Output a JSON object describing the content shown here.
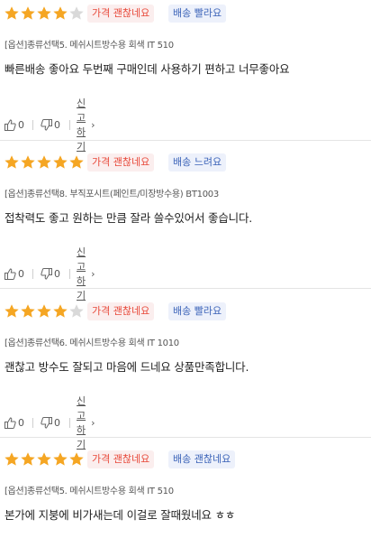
{
  "colors": {
    "star_filled": "#f5a623",
    "star_empty": "#d9d9d9",
    "price_tag_text": "#e8493a",
    "shipping_tag_text": "#3b63b8"
  },
  "actions": {
    "like_icon": "thumbs-up-icon",
    "dislike_icon": "thumbs-down-icon",
    "report_label": "신고하기",
    "report_chevron": "›"
  },
  "reviews": [
    {
      "rating": 4,
      "price_tag": "가격 괜찮네요",
      "shipping_tag": "배송 빨라요",
      "option": "[옵션]종류선택5. 메쉬시트방수용 회색 IT 510",
      "content": "빠른배송 좋아요 두번째 구매인데 사용하기 편하고 너무좋아요",
      "likes": "0",
      "dislikes": "0"
    },
    {
      "rating": 5,
      "price_tag": "가격 괜찮네요",
      "shipping_tag": "배송 느려요",
      "option": "[옵션]종류선택8. 부직포시트(페인트/미장방수용) BT1003",
      "content": "접착력도 좋고 원하는 만큼 잘라 쓸수있어서 좋습니다.",
      "likes": "0",
      "dislikes": "0"
    },
    {
      "rating": 4,
      "price_tag": "가격 괜찮네요",
      "shipping_tag": "배송 빨라요",
      "option": "[옵션]종류선택6. 메쉬시트방수용 회색 IT 1010",
      "content": "괜찮고 방수도 잘되고 마음에 드네요 상품만족합니다.",
      "likes": "0",
      "dislikes": "0"
    },
    {
      "rating": 5,
      "price_tag": "가격 괜찮네요",
      "shipping_tag": "배송 괜찮네요",
      "option": "[옵션]종류선택5. 메쉬시트방수용 회색 IT 510",
      "content": "본가에 지붕에 비가새는데 이걸로 잘때웠네요 ㅎㅎ"
    }
  ]
}
